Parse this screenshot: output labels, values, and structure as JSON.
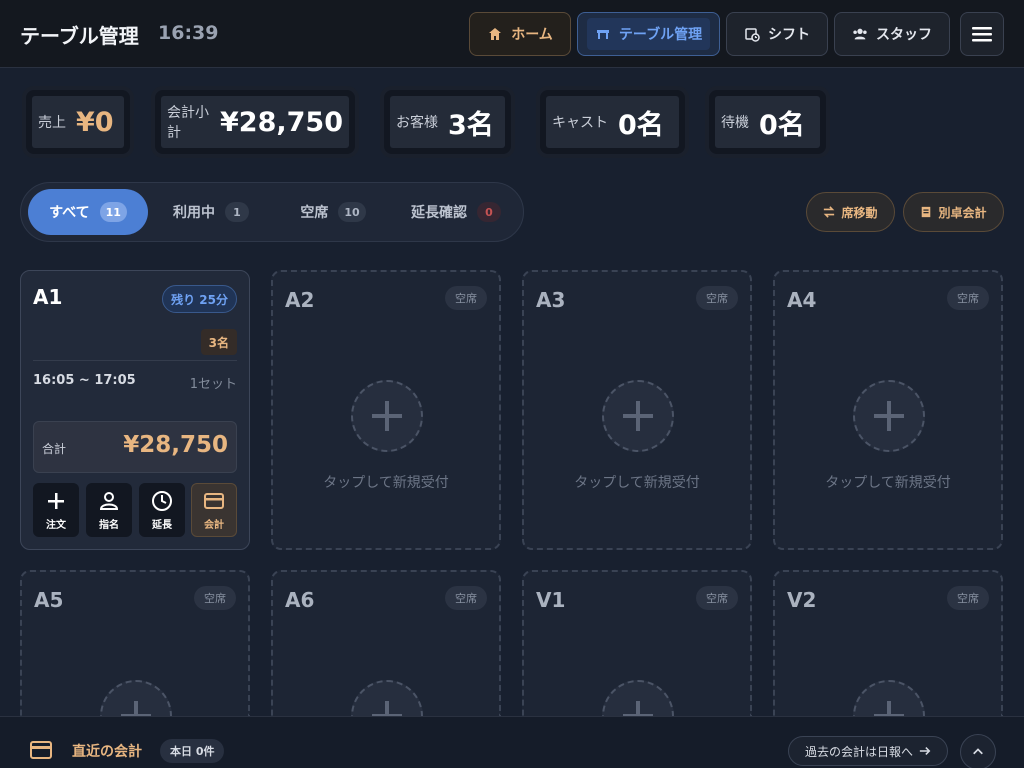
{
  "header": {
    "title": "テーブル管理",
    "clock": "16:39",
    "nav": {
      "home": "ホーム",
      "tables": "テーブル管理",
      "shift": "シフト",
      "staff": "スタッフ"
    }
  },
  "stats": {
    "sales": {
      "label": "売上",
      "value": "¥0"
    },
    "subtotal": {
      "label": "会計小計",
      "value": "¥28,750"
    },
    "guests": {
      "label": "お客様",
      "value": "3名"
    },
    "cast": {
      "label": "キャスト",
      "value": "0名"
    },
    "waiting": {
      "label": "待機",
      "value": "0名"
    }
  },
  "filters": [
    {
      "label": "すべて",
      "count": "11"
    },
    {
      "label": "利用中",
      "count": "1"
    },
    {
      "label": "空席",
      "count": "10"
    },
    {
      "label": "延長確認",
      "count": "0"
    }
  ],
  "actions": {
    "move": "席移動",
    "split": "別卓会計"
  },
  "active_table": {
    "name": "A1",
    "remaining": "残り 25分",
    "guests": "3名",
    "time": "16:05 ~ 17:05",
    "set": "1セット",
    "total_label": "合計",
    "total_value": "¥28,750",
    "buttons": {
      "order": "注文",
      "nominate": "指名",
      "extend": "延長",
      "pay": "会計"
    }
  },
  "empty_tables": [
    {
      "name": "A2",
      "status": "空席",
      "hint": "タップして新規受付"
    },
    {
      "name": "A3",
      "status": "空席",
      "hint": "タップして新規受付"
    },
    {
      "name": "A4",
      "status": "空席",
      "hint": "タップして新規受付"
    },
    {
      "name": "A5",
      "status": "空席",
      "hint": ""
    },
    {
      "name": "A6",
      "status": "空席",
      "hint": ""
    },
    {
      "name": "V1",
      "status": "空席",
      "hint": ""
    },
    {
      "name": "V2",
      "status": "空席",
      "hint": ""
    }
  ],
  "footer": {
    "title": "直近の会計",
    "today": "本日 0件",
    "history": "過去の会計は日報へ"
  },
  "colors": {
    "accent_gold": "#e8b681",
    "accent_blue": "#4c7fd4",
    "background": "#18202f"
  }
}
